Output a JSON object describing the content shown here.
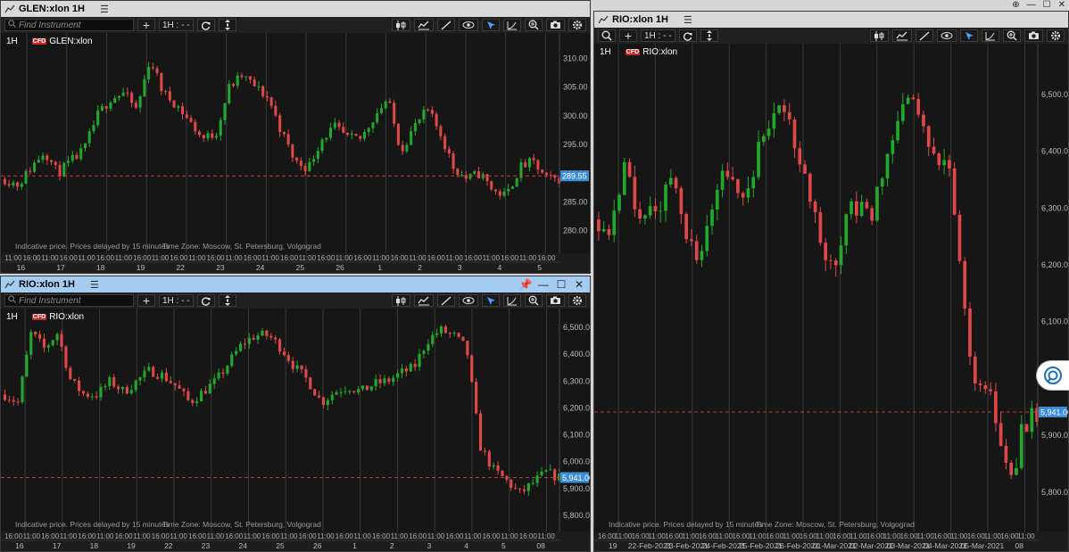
{
  "windows": [
    {
      "id": "w1",
      "title": "GLEN:xlon 1H",
      "active": false,
      "has_search": true,
      "search_placeholder": "Find Instrument",
      "interval": "1H : - -",
      "period_label": "1H",
      "symbol": "GLEN:xlon",
      "badge": "CFD",
      "price_ticks": [
        "310.00",
        "305.00",
        "300.00",
        "295.00",
        "290.00",
        "285.00",
        "280.00"
      ],
      "price_range": [
        277.0,
        313.5
      ],
      "current_price": "289.55",
      "current_value": 289.55,
      "disclaimer": "Indicative price. Prices delayed by 15 minutes",
      "timezone": "Time Zone: Moscow, St. Petersburg, Volgograd",
      "time_labels": [
        "11:00",
        "16:00",
        "11:00",
        "16:00",
        "11:00",
        "16:00",
        "11:00",
        "16:00",
        "11:00",
        "16:00",
        "11:00",
        "16:00",
        "11:00",
        "16:00",
        "11:00",
        "16:00",
        "11:00",
        "16:00",
        "11:00",
        "16:00",
        "11:00",
        "16:00",
        "11:00",
        "16:00",
        "11:00",
        "16:00",
        "11:00",
        "16:00",
        "11:00",
        "16:00"
      ],
      "date_labels": [
        "16",
        "17",
        "18",
        "19",
        "22",
        "23",
        "24",
        "25",
        "26",
        "1",
        "2",
        "3",
        "4",
        "5"
      ],
      "candles_seed": 11,
      "candles_count": 132,
      "candles_path": [
        289,
        288,
        291,
        294,
        290,
        292,
        294,
        300,
        303,
        304,
        301,
        310,
        304,
        302,
        299,
        296,
        297,
        305,
        307,
        305,
        303,
        297,
        292,
        291,
        296,
        298,
        296,
        296,
        300,
        303,
        294,
        298,
        301,
        297,
        291,
        289,
        290,
        287,
        286,
        291,
        292,
        289,
        289
      ]
    },
    {
      "id": "w2",
      "title": "RIO:xlon 1H",
      "active": true,
      "has_search": true,
      "search_placeholder": "Find Instrument",
      "interval": "1H : - -",
      "period_label": "1H",
      "symbol": "RIO:xlon",
      "badge": "CFD",
      "price_ticks": [
        "6,500.00",
        "6,400.00",
        "6,300.00",
        "6,200.00",
        "6,100.00",
        "6,000.00",
        "5,900.00",
        "5,800.00"
      ],
      "price_range": [
        5760,
        6550
      ],
      "current_price": "5,941.00",
      "current_value": 5941,
      "disclaimer": "Indicative price. Prices delayed by 15 minutes",
      "timezone": "Time Zone: Moscow, St. Petersburg, Volgograd",
      "time_labels": [
        "16:00",
        "11:00",
        "16:00",
        "11:00",
        "16:00",
        "11:00",
        "16:00",
        "11:00",
        "16:00",
        "11:00",
        "16:00",
        "11:00",
        "16:00",
        "11:00",
        "16:00",
        "11:00",
        "16:00",
        "11:00",
        "16:00",
        "11:00",
        "16:00",
        "11:00",
        "16:00",
        "11:00",
        "16:00",
        "11:00",
        "16:00",
        "11:00",
        "16:00",
        "11:00"
      ],
      "date_labels": [
        "16",
        "17",
        "18",
        "19",
        "22",
        "23",
        "24",
        "25",
        "26",
        "1",
        "2",
        "3",
        "4",
        "5",
        "08"
      ],
      "candles_seed": 7,
      "candles_count": 128,
      "candles_path": [
        6250,
        6220,
        6480,
        6420,
        6480,
        6300,
        6250,
        6250,
        6300,
        6260,
        6300,
        6340,
        6320,
        6280,
        6220,
        6260,
        6300,
        6370,
        6440,
        6470,
        6470,
        6420,
        6350,
        6300,
        6220,
        6260,
        6280,
        6260,
        6290,
        6300,
        6330,
        6350,
        6450,
        6490,
        6470,
        6420,
        6060,
        5970,
        5930,
        5880,
        5920,
        5960,
        5941
      ]
    },
    {
      "id": "w3",
      "title": "RIO:xlon 1H",
      "active": false,
      "has_search": false,
      "search_placeholder": "",
      "interval": "1H : - -",
      "period_label": "1H",
      "symbol": "RIO:xlon",
      "badge": "CFD",
      "price_ticks": [
        "6,500.00",
        "6,400.00",
        "6,300.00",
        "6,200.00",
        "6,100.00",
        "6,000.00",
        "5,900.00",
        "5,800.00"
      ],
      "price_range": [
        5740,
        6580
      ],
      "current_price": "5,941.00",
      "current_value": 5941,
      "disclaimer": "Indicative price. Prices delayed by 15 minutes",
      "timezone": "Time Zone: Moscow, St. Petersburg, Volgograd",
      "time_labels": [
        "16:00",
        "11:00",
        "16:00",
        "11:00",
        "16:00",
        "11:00",
        "16:00",
        "11:00",
        "16:00",
        "11:00",
        "16:00",
        "11:00",
        "16:00",
        "11:00",
        "16:00",
        "11:00",
        "16:00",
        "11:00",
        "16:00",
        "11:00",
        "16:00",
        "11:00",
        "16:00",
        "11:00",
        "16:00",
        "11:00"
      ],
      "date_labels": [
        "19",
        "22-Feb-2021",
        "23-Feb-2021",
        "24-Feb-2021",
        "25-Feb-2021",
        "26-Feb-2021",
        "01-Mar-2021",
        "02-Mar-2021",
        "03-Mar-2021",
        "04-Mar-2021",
        "05-Mar-2021",
        "08"
      ],
      "candles_seed": 5,
      "candles_count": 86,
      "candles_path": [
        6280,
        6260,
        6380,
        6290,
        6300,
        6310,
        6360,
        6250,
        6200,
        6300,
        6380,
        6320,
        6330,
        6440,
        6470,
        6460,
        6400,
        6320,
        6200,
        6180,
        6300,
        6290,
        6300,
        6380,
        6470,
        6490,
        6450,
        6390,
        6380,
        6150,
        6010,
        5980,
        5900,
        5830,
        5920,
        5941
      ]
    }
  ],
  "tool_icons": [
    "candles-icon",
    "indicators-icon",
    "draw-line-icon",
    "eye-icon",
    "cursor-icon",
    "curve-icon",
    "zoom-icon",
    "camera-icon",
    "gear-icon"
  ],
  "colors": {
    "up": "#22a82c",
    "down": "#e04848",
    "price_line": "#c83b3b",
    "price_tag": "#3d8ed8",
    "grid": "#3a3a3a"
  }
}
